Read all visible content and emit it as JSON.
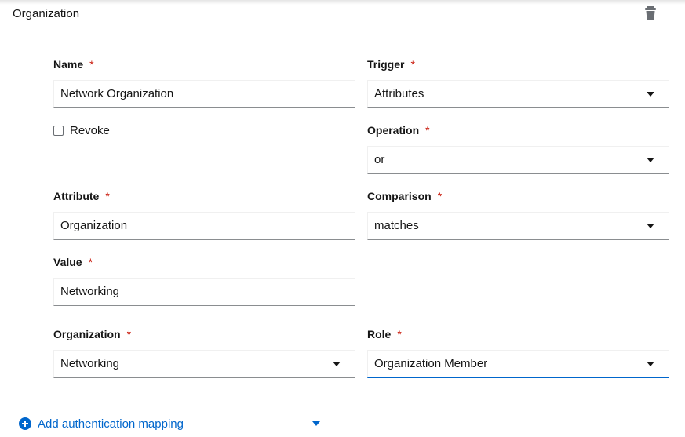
{
  "section": {
    "title": "Organization"
  },
  "form": {
    "name": {
      "label": "Name",
      "required": "*",
      "value": "Network Organization"
    },
    "revoke": {
      "label": "Revoke",
      "checked": false
    },
    "trigger": {
      "label": "Trigger",
      "required": "*",
      "value": "Attributes"
    },
    "operation": {
      "label": "Operation",
      "required": "*",
      "value": "or"
    },
    "attribute": {
      "label": "Attribute",
      "required": "*",
      "value": "Organization"
    },
    "comparison": {
      "label": "Comparison",
      "required": "*",
      "value": "matches"
    },
    "value": {
      "label": "Value",
      "required": "*",
      "value": "Networking"
    },
    "organization": {
      "label": "Organization",
      "required": "*",
      "value": "Networking"
    },
    "role": {
      "label": "Role",
      "required": "*",
      "value": "Organization Member"
    }
  },
  "actions": {
    "add_mapping": "Add authentication mapping"
  },
  "colors": {
    "accent": "#0066cc",
    "required": "#c9190b"
  },
  "icons": {
    "delete": "trash-icon",
    "add": "plus-circle-icon",
    "dropdown": "caret-down-icon"
  }
}
